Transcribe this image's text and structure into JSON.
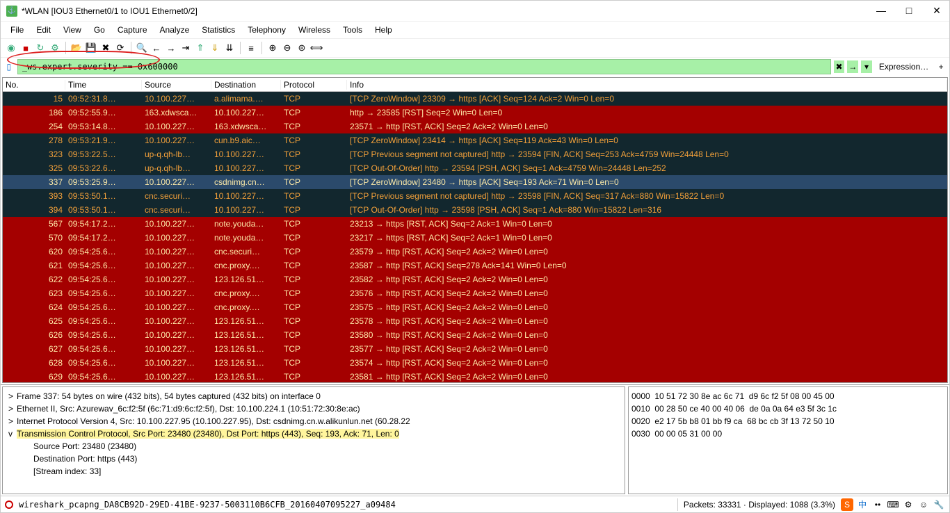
{
  "title": "*WLAN [IOU3 Ethernet0/1 to IOU1 Ethernet0/2]",
  "menus": [
    "File",
    "Edit",
    "View",
    "Go",
    "Capture",
    "Analyze",
    "Statistics",
    "Telephony",
    "Wireless",
    "Tools",
    "Help"
  ],
  "filter": "_ws.expert.severity == 0x600000",
  "expression_label": "Expression…",
  "columns": {
    "no": "No.",
    "time": "Time",
    "src": "Source",
    "dst": "Destination",
    "proto": "Protocol",
    "info": "Info"
  },
  "rows": [
    {
      "no": "15",
      "time": "09:52:31.8…",
      "src": "10.100.227…",
      "dst": "a.alimama.…",
      "proto": "TCP",
      "info": "[TCP ZeroWindow] 23309 → https [ACK] Seq=124 Ack=2 Win=0 Len=0",
      "cls": "row-dark"
    },
    {
      "no": "186",
      "time": "09:52:55.9…",
      "src": "163.xdwsca…",
      "dst": "10.100.227…",
      "proto": "TCP",
      "info": "http → 23585 [RST] Seq=2 Win=0 Len=0",
      "cls": "row-red"
    },
    {
      "no": "254",
      "time": "09:53:14.8…",
      "src": "10.100.227…",
      "dst": "163.xdwsca…",
      "proto": "TCP",
      "info": "23571 → http [RST, ACK] Seq=2 Ack=2 Win=0 Len=0",
      "cls": "row-red"
    },
    {
      "no": "278",
      "time": "09:53:21.9…",
      "src": "10.100.227…",
      "dst": "cun.b9.aic…",
      "proto": "TCP",
      "info": "[TCP ZeroWindow] 23414 → https [ACK] Seq=119 Ack=43 Win=0 Len=0",
      "cls": "row-dark"
    },
    {
      "no": "323",
      "time": "09:53:22.5…",
      "src": "up-q.qh-lb…",
      "dst": "10.100.227…",
      "proto": "TCP",
      "info": "[TCP Previous segment not captured] http → 23594 [FIN, ACK] Seq=253 Ack=4759 Win=24448 Len=0",
      "cls": "row-dark"
    },
    {
      "no": "325",
      "time": "09:53:22.6…",
      "src": "up-q.qh-lb…",
      "dst": "10.100.227…",
      "proto": "TCP",
      "info": "[TCP Out-Of-Order] http → 23594 [PSH, ACK] Seq=1 Ack=4759 Win=24448 Len=252",
      "cls": "row-dark"
    },
    {
      "no": "337",
      "time": "09:53:25.9…",
      "src": "10.100.227…",
      "dst": "csdnimg.cn…",
      "proto": "TCP",
      "info": "[TCP ZeroWindow] 23480 → https [ACK] Seq=193 Ack=71 Win=0 Len=0",
      "cls": "row-sel"
    },
    {
      "no": "393",
      "time": "09:53:50.1…",
      "src": "cnc.securi…",
      "dst": "10.100.227…",
      "proto": "TCP",
      "info": "[TCP Previous segment not captured] http → 23598 [FIN, ACK] Seq=317 Ack=880 Win=15822 Len=0",
      "cls": "row-dark"
    },
    {
      "no": "394",
      "time": "09:53:50.1…",
      "src": "cnc.securi…",
      "dst": "10.100.227…",
      "proto": "TCP",
      "info": "[TCP Out-Of-Order] http → 23598 [PSH, ACK] Seq=1 Ack=880 Win=15822 Len=316",
      "cls": "row-dark"
    },
    {
      "no": "567",
      "time": "09:54:17.2…",
      "src": "10.100.227…",
      "dst": "note.youda…",
      "proto": "TCP",
      "info": "23213 → https [RST, ACK] Seq=2 Ack=1 Win=0 Len=0",
      "cls": "row-red"
    },
    {
      "no": "570",
      "time": "09:54:17.2…",
      "src": "10.100.227…",
      "dst": "note.youda…",
      "proto": "TCP",
      "info": "23217 → https [RST, ACK] Seq=2 Ack=1 Win=0 Len=0",
      "cls": "row-red"
    },
    {
      "no": "620",
      "time": "09:54:25.6…",
      "src": "10.100.227…",
      "dst": "cnc.securi…",
      "proto": "TCP",
      "info": "23579 → http [RST, ACK] Seq=2 Ack=2 Win=0 Len=0",
      "cls": "row-red"
    },
    {
      "no": "621",
      "time": "09:54:25.6…",
      "src": "10.100.227…",
      "dst": "cnc.proxy.…",
      "proto": "TCP",
      "info": "23587 → http [RST, ACK] Seq=278 Ack=141 Win=0 Len=0",
      "cls": "row-red"
    },
    {
      "no": "622",
      "time": "09:54:25.6…",
      "src": "10.100.227…",
      "dst": "123.126.51…",
      "proto": "TCP",
      "info": "23582 → http [RST, ACK] Seq=2 Ack=2 Win=0 Len=0",
      "cls": "row-red"
    },
    {
      "no": "623",
      "time": "09:54:25.6…",
      "src": "10.100.227…",
      "dst": "cnc.proxy.…",
      "proto": "TCP",
      "info": "23576 → http [RST, ACK] Seq=2 Ack=2 Win=0 Len=0",
      "cls": "row-red"
    },
    {
      "no": "624",
      "time": "09:54:25.6…",
      "src": "10.100.227…",
      "dst": "cnc.proxy.…",
      "proto": "TCP",
      "info": "23575 → http [RST, ACK] Seq=2 Ack=2 Win=0 Len=0",
      "cls": "row-red"
    },
    {
      "no": "625",
      "time": "09:54:25.6…",
      "src": "10.100.227…",
      "dst": "123.126.51…",
      "proto": "TCP",
      "info": "23578 → http [RST, ACK] Seq=2 Ack=2 Win=0 Len=0",
      "cls": "row-red"
    },
    {
      "no": "626",
      "time": "09:54:25.6…",
      "src": "10.100.227…",
      "dst": "123.126.51…",
      "proto": "TCP",
      "info": "23580 → http [RST, ACK] Seq=2 Ack=2 Win=0 Len=0",
      "cls": "row-red"
    },
    {
      "no": "627",
      "time": "09:54:25.6…",
      "src": "10.100.227…",
      "dst": "123.126.51…",
      "proto": "TCP",
      "info": "23577 → http [RST, ACK] Seq=2 Ack=2 Win=0 Len=0",
      "cls": "row-red"
    },
    {
      "no": "628",
      "time": "09:54:25.6…",
      "src": "10.100.227…",
      "dst": "123.126.51…",
      "proto": "TCP",
      "info": "23574 → http [RST, ACK] Seq=2 Ack=2 Win=0 Len=0",
      "cls": "row-red"
    },
    {
      "no": "629",
      "time": "09:54:25.6…",
      "src": "10.100.227…",
      "dst": "123.126.51…",
      "proto": "TCP",
      "info": "23581 → http [RST, ACK] Seq=2 Ack=2 Win=0 Len=0",
      "cls": "row-red"
    }
  ],
  "tree": [
    {
      "exp": ">",
      "text": "Frame 337: 54 bytes on wire (432 bits), 54 bytes captured (432 bits) on interface 0",
      "hl": false,
      "indent": 0
    },
    {
      "exp": ">",
      "text": "Ethernet II, Src: Azurewav_6c:f2:5f (6c:71:d9:6c:f2:5f), Dst: 10.100.224.1 (10:51:72:30:8e:ac)",
      "hl": false,
      "indent": 0
    },
    {
      "exp": ">",
      "text": "Internet Protocol Version 4, Src: 10.100.227.95 (10.100.227.95), Dst: csdnimg.cn.w.alikunlun.net (60.28.22",
      "hl": false,
      "indent": 0
    },
    {
      "exp": "v",
      "text": "Transmission Control Protocol, Src Port: 23480 (23480), Dst Port: https (443), Seq: 193, Ack: 71, Len: 0",
      "hl": true,
      "indent": 0
    },
    {
      "exp": "",
      "text": "Source Port: 23480 (23480)",
      "hl": false,
      "indent": 1
    },
    {
      "exp": "",
      "text": "Destination Port: https (443)",
      "hl": false,
      "indent": 1
    },
    {
      "exp": "",
      "text": "[Stream index: 33]",
      "hl": false,
      "indent": 1
    }
  ],
  "hex": [
    {
      "off": "0000",
      "b": "10 51 72 30 8e ac 6c 71  d9 6c f2 5f 08 00 45 00"
    },
    {
      "off": "0010",
      "b": "00 28 50 ce 40 00 40 06  de 0a 0a 64 e3 5f 3c 1c"
    },
    {
      "off": "0020",
      "b": "e2 17 5b b8 01 bb f9 ca  68 bc cb 3f 13 72 50 10"
    },
    {
      "off": "0030",
      "b": "00 00 05 31 00 00"
    }
  ],
  "status_file": "wireshark_pcapng_DA8CB92D-29ED-41BE-9237-5003110B6CFB_20160407095227_a09484",
  "status_packets": "Packets: 33331 · Displayed: 1088 (3.3%)"
}
